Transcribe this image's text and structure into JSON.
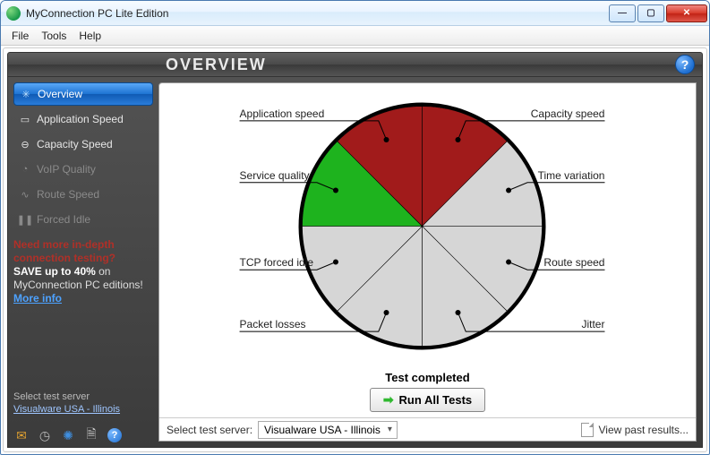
{
  "window": {
    "title": "MyConnection PC Lite Edition"
  },
  "menu": {
    "file": "File",
    "tools": "Tools",
    "help": "Help"
  },
  "header": {
    "title": "OVERVIEW"
  },
  "sidebar": {
    "items": [
      {
        "label": "Overview"
      },
      {
        "label": "Application Speed"
      },
      {
        "label": "Capacity Speed"
      },
      {
        "label": "VoIP Quality"
      },
      {
        "label": "Route Speed"
      },
      {
        "label": "Forced Idle"
      }
    ],
    "promo": {
      "line1": "Need more in-depth",
      "line2": "connection testing?",
      "save_prefix": "SAVE up to 40%",
      "save_suffix": " on MyConnection PC editions! ",
      "link": "More info"
    },
    "server": {
      "label": "Select test server",
      "link": "Visualware USA - Illinois"
    }
  },
  "chart_data": {
    "type": "pie",
    "title": "",
    "segments": [
      {
        "name": "Capacity speed",
        "value": 1,
        "color": "#a11b1b"
      },
      {
        "name": "Time variation",
        "value": 1,
        "color": "#d6d6d6"
      },
      {
        "name": "Route speed",
        "value": 1,
        "color": "#d6d6d6"
      },
      {
        "name": "Jitter",
        "value": 1,
        "color": "#d6d6d6"
      },
      {
        "name": "Packet losses",
        "value": 1,
        "color": "#d6d6d6"
      },
      {
        "name": "TCP forced idle",
        "value": 1,
        "color": "#d6d6d6"
      },
      {
        "name": "Service quality",
        "value": 1,
        "color": "#1eb31e"
      },
      {
        "name": "Application speed",
        "value": 1,
        "color": "#a11b1b"
      }
    ],
    "label_side": [
      "right",
      "right",
      "right",
      "right",
      "left",
      "left",
      "left",
      "left"
    ]
  },
  "status": {
    "text": "Test completed",
    "run_label": "Run All Tests"
  },
  "bottom": {
    "label": "Select test server:",
    "selected": "Visualware USA - Illinois",
    "view_past": "View past results..."
  }
}
